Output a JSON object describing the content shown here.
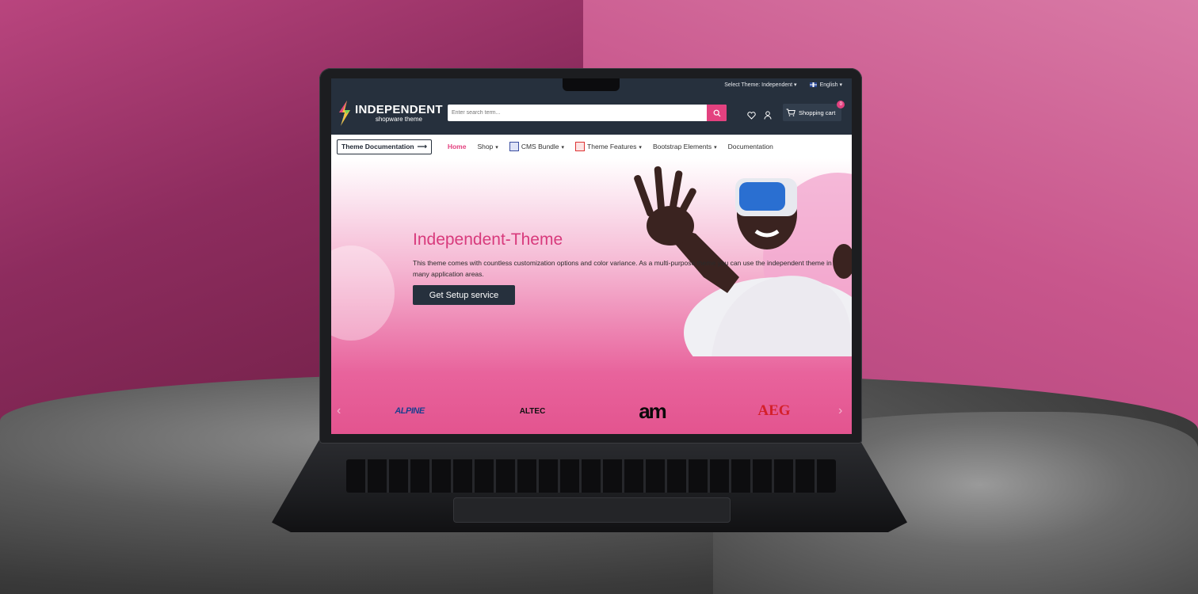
{
  "topbar": {
    "theme_select": "Select Theme: Independent",
    "language": "English"
  },
  "header": {
    "logo_title": "INDEPENDENT",
    "logo_subtitle": "shopware theme",
    "search_placeholder": "Enter search term...",
    "cart_label": "Shopping cart",
    "cart_count": "0"
  },
  "nav": {
    "doc_button": "Theme Documentation",
    "items": [
      {
        "label": "Home"
      },
      {
        "label": "Shop"
      },
      {
        "label": "CMS Bundle"
      },
      {
        "label": "Theme Features"
      },
      {
        "label": "Bootstrap Elements"
      },
      {
        "label": "Documentation"
      }
    ]
  },
  "hero": {
    "title": "Independent-Theme",
    "text": "This theme comes with countless customization options and color variance. As a multi-purpose theme you can use the independent theme in many application areas.",
    "button": "Get Setup service"
  },
  "brands": [
    "ALPINE",
    "ALTEC",
    "am",
    "AEG"
  ],
  "colors": {
    "accent": "#e3417f",
    "header_bg": "#26303d"
  }
}
